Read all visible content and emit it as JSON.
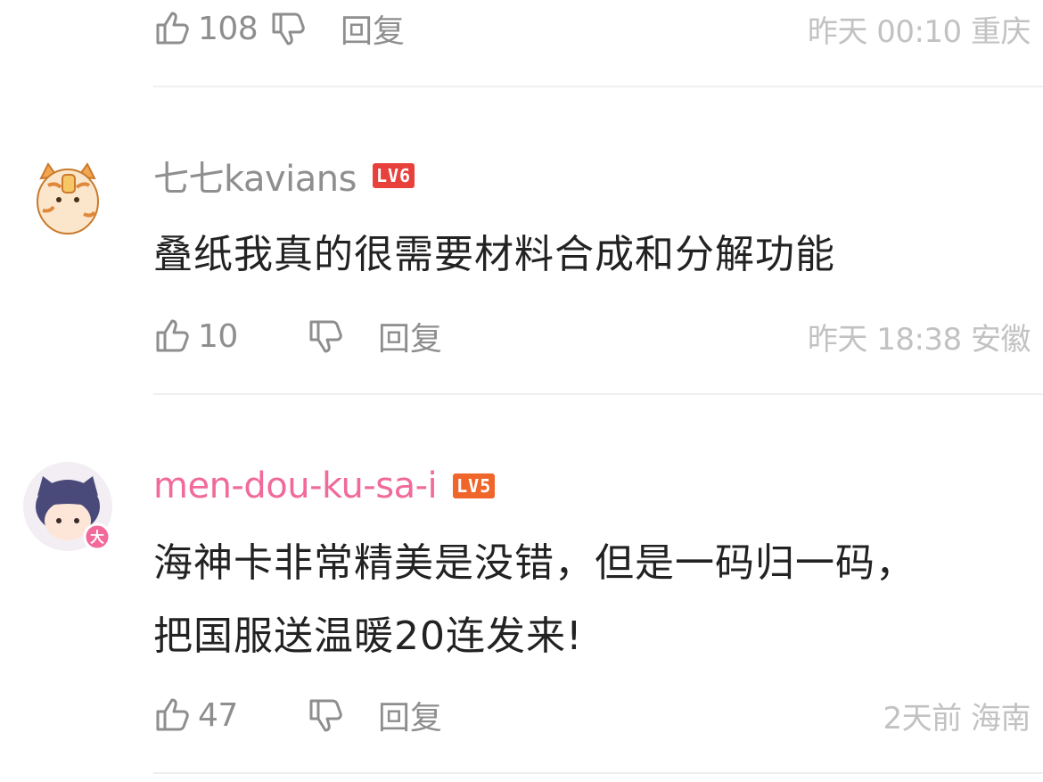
{
  "comments": [
    {
      "likes": "108",
      "reply_label": "回复",
      "meta": "昨天 00:10 重庆"
    },
    {
      "username": "七七kavians",
      "level": "LV6",
      "text": "叠纸我真的很需要材料合成和分解功能",
      "likes": "10",
      "reply_label": "回复",
      "meta": "昨天 18:38 安徽"
    },
    {
      "username": "men-dou-ku-sa-i",
      "level": "LV5",
      "text_line1": "海神卡非常精美是没错，但是一码归一码，",
      "text_line2": "把国服送温暖20连发来!",
      "likes": "47",
      "reply_label": "回复",
      "meta": "2天前 海南"
    }
  ],
  "colors": {
    "username_default": "#8f8f8f",
    "username_pink": "#f06a9b",
    "lv6_badge": "#e8413c",
    "lv5_badge": "#f0662a",
    "meta_text": "#c2c2c2"
  },
  "icons": [
    "thumbs-up-icon",
    "thumbs-down-icon"
  ]
}
